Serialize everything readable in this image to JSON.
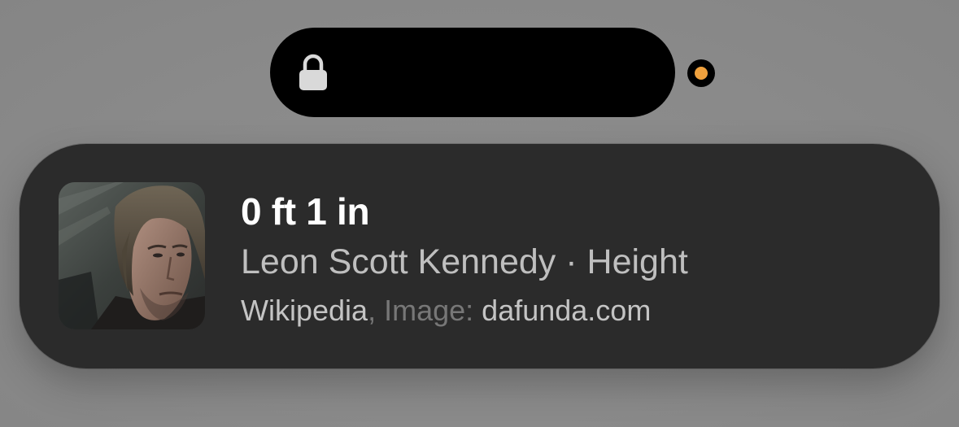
{
  "status": {
    "icons": {
      "lock": "lock-icon",
      "privacy_indicator": "privacy-indicator-dot"
    },
    "indicator_color": "#f0a13d"
  },
  "result_card": {
    "headline": "0 ft 1 in",
    "subtitle_name": "Leon Scott Kennedy",
    "subtitle_separator": "·",
    "subtitle_attribute": "Height",
    "source_name": "Wikipedia",
    "source_separator": ",",
    "image_credit_label": "Image:",
    "image_credit_source": "dafunda.com",
    "thumbnail_icon": "character-portrait-thumbnail"
  }
}
